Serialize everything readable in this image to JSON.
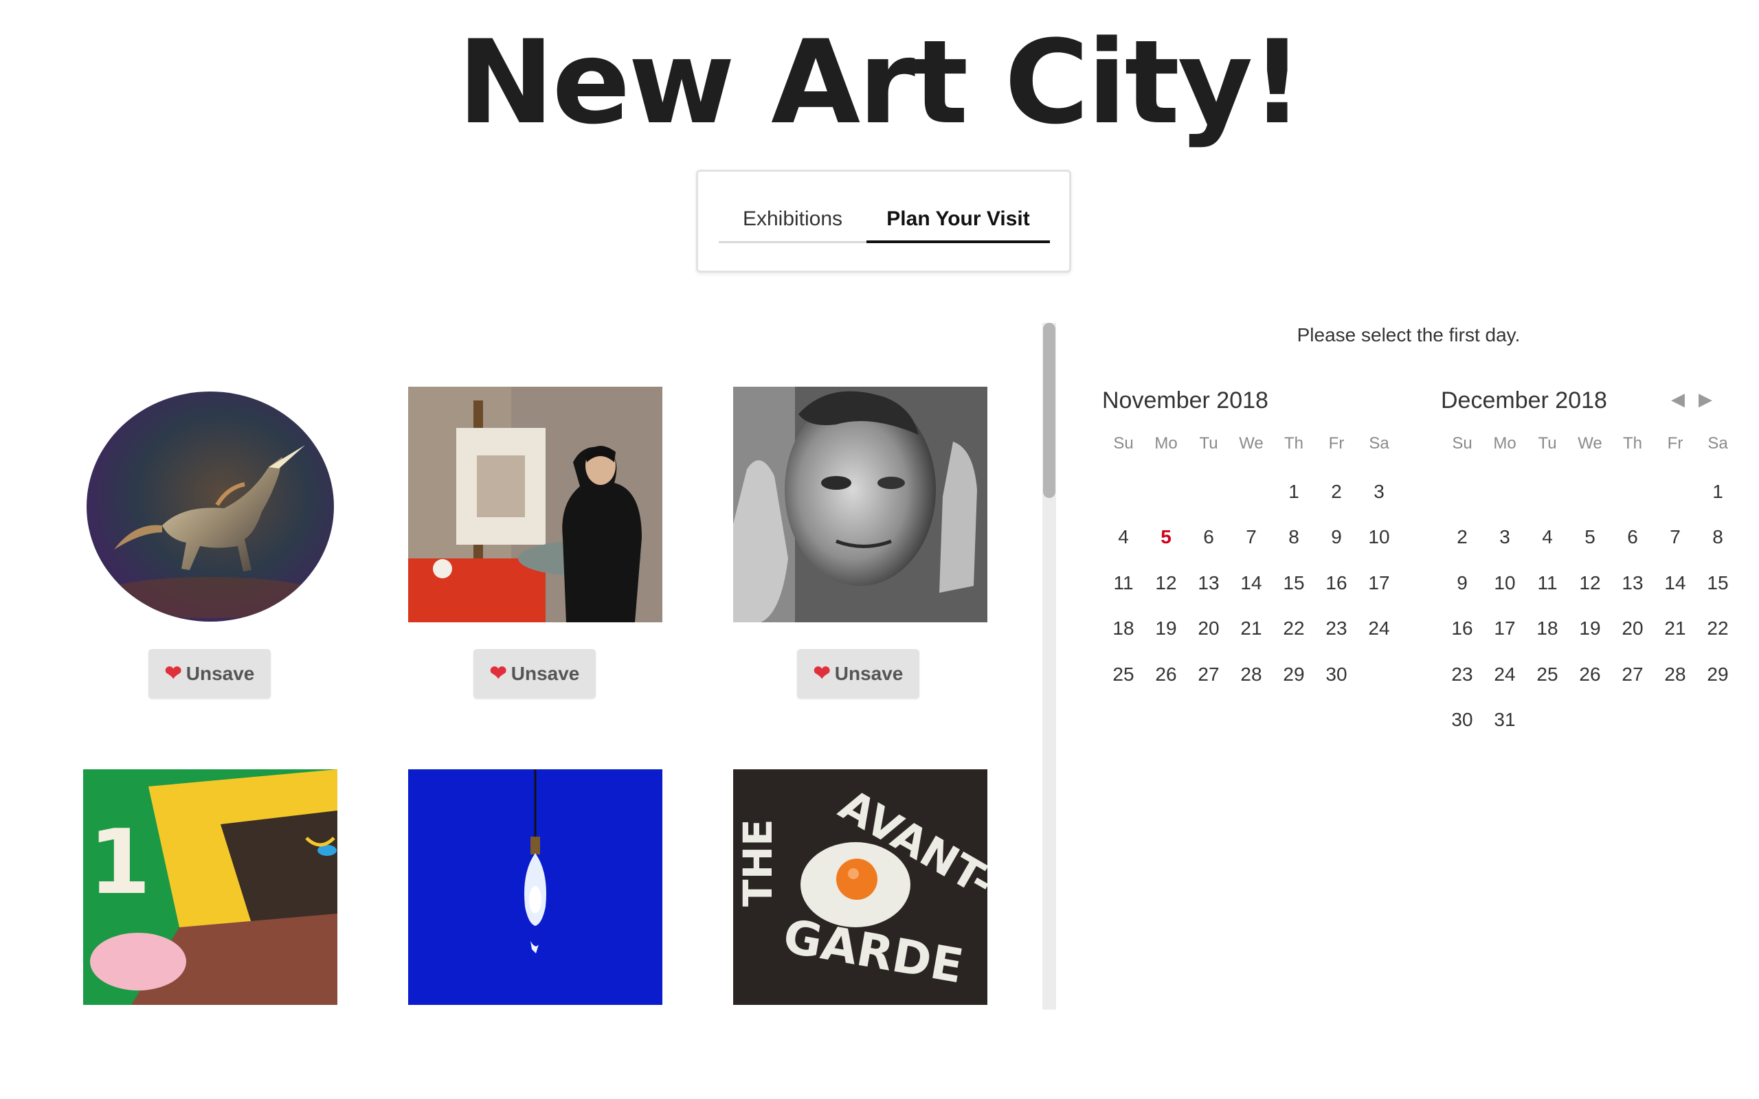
{
  "page": {
    "title": "New Art City!"
  },
  "tabs": [
    {
      "label": "Exhibitions"
    },
    {
      "label": "Plan Your Visit"
    }
  ],
  "gallery": {
    "unsave_label": "Unsave",
    "items": [
      {
        "name": "unicorn-artwork"
      },
      {
        "name": "painter-artwork"
      },
      {
        "name": "portrait-artwork"
      },
      {
        "name": "abstract-face-artwork"
      },
      {
        "name": "lightbulb-artwork"
      },
      {
        "name": "avant-garde-artwork",
        "text": [
          "THE",
          "AVANT-",
          "GARDE"
        ]
      }
    ]
  },
  "calendar": {
    "prompt": "Please select the first day.",
    "weekdays": [
      "Su",
      "Mo",
      "Tu",
      "We",
      "Th",
      "Fr",
      "Sa"
    ],
    "months": [
      {
        "label": "November 2018",
        "first_weekday": 4,
        "days": 30,
        "today": 5
      },
      {
        "label": "December 2018",
        "first_weekday": 6,
        "days": 31
      }
    ],
    "prev_icon": "triangle-left-icon",
    "next_icon": "triangle-right-icon"
  },
  "colors": {
    "heart": "#e0303b",
    "today": "#d0021b"
  }
}
